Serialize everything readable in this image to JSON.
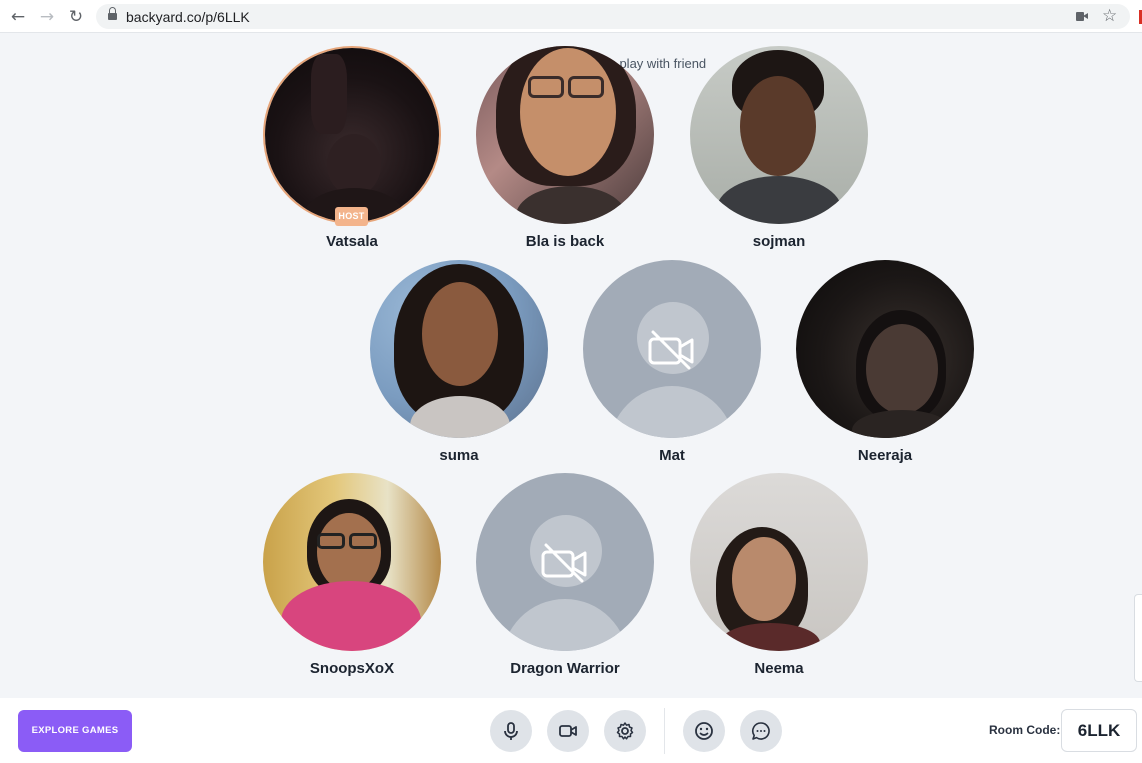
{
  "browser": {
    "url": "backyard.co/p/6LLK",
    "back_icon": "arrow-left-icon",
    "forward_icon": "arrow-right-icon",
    "reload_icon": "reload-icon"
  },
  "background_text": "to play with friend",
  "participants": [
    {
      "name": "Vatsala",
      "host": true,
      "host_label": "HOST",
      "video": "on"
    },
    {
      "name": "Bla is back",
      "video": "on"
    },
    {
      "name": "sojman",
      "video": "on"
    },
    {
      "name": "suma",
      "video": "on"
    },
    {
      "name": "Mat",
      "video": "off"
    },
    {
      "name": "Neeraja",
      "video": "on"
    },
    {
      "name": "SnoopsXoX",
      "video": "on"
    },
    {
      "name": "Dragon Warrior",
      "video": "off"
    },
    {
      "name": "Neema",
      "video": "on"
    }
  ],
  "bottom_bar": {
    "explore_label": "EXPLORE GAMES",
    "controls": [
      "microphone-icon",
      "video-camera-icon",
      "settings-gear-icon",
      "emoji-icon",
      "chat-icon"
    ],
    "room_code_label": "Room Code:",
    "room_code": "6LLK"
  },
  "colors": {
    "accent": "#8b5cf6",
    "host_badge": "#f3b48c",
    "background": "#f3f5f8",
    "camera_off": "#a2abb7"
  }
}
